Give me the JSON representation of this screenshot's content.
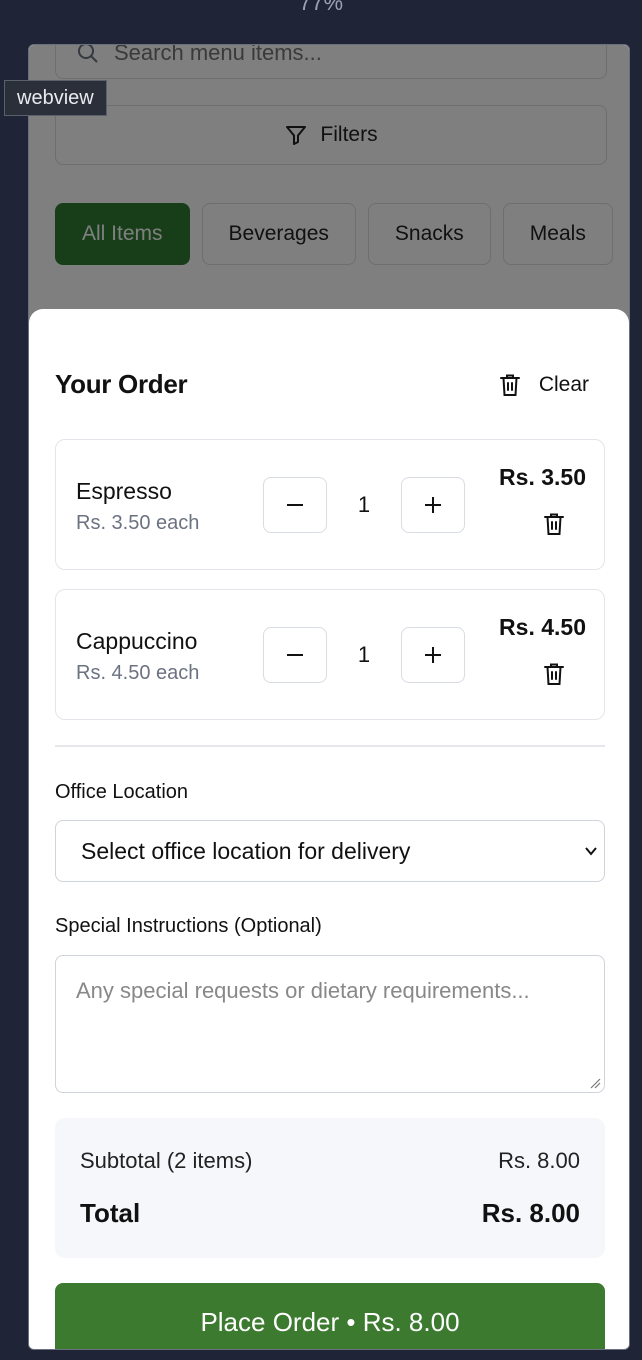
{
  "zoom_label": "77%",
  "webview_label": "webview",
  "menu": {
    "search_placeholder": "Search menu items...",
    "filters_label": "Filters",
    "categories": [
      "All Items",
      "Beverages",
      "Snacks",
      "Meals"
    ],
    "active_category": "All Items"
  },
  "order": {
    "title": "Your Order",
    "clear_label": "Clear",
    "items": [
      {
        "name": "Espresso",
        "each": "Rs. 3.50 each",
        "qty": "1",
        "total": "Rs. 3.50"
      },
      {
        "name": "Cappuccino",
        "each": "Rs. 4.50 each",
        "qty": "1",
        "total": "Rs. 4.50"
      }
    ],
    "office_location_label": "Office Location",
    "office_location_value": "Select office location for delivery",
    "instructions_label": "Special Instructions (Optional)",
    "instructions_placeholder": "Any special requests or dietary requirements...",
    "subtotal_label": "Subtotal (2 items)",
    "subtotal_value": "Rs. 8.00",
    "total_label": "Total",
    "total_value": "Rs. 8.00",
    "place_order_label": "Place Order • Rs. 8.00"
  },
  "colors": {
    "page_bg": "#1f2537",
    "accent_green": "#3c7a2f",
    "summary_bg": "#f5f7fa"
  }
}
